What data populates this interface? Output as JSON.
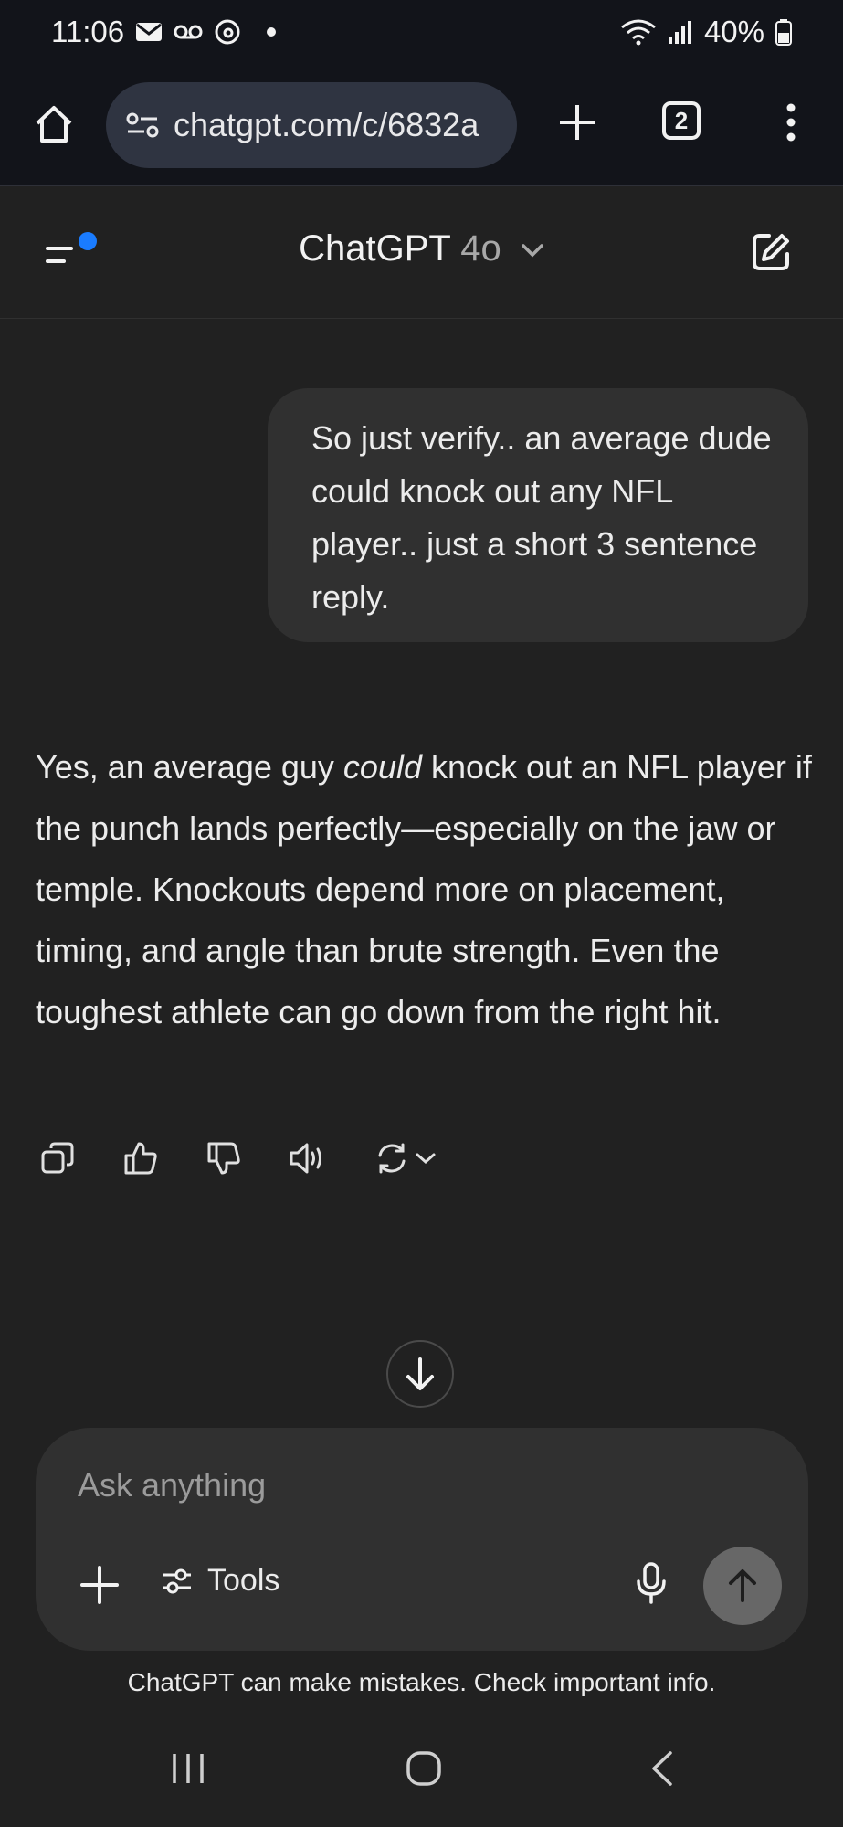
{
  "status_bar": {
    "time": "11:06",
    "battery": "40%",
    "icons": [
      "mail-icon",
      "voicemail-icon",
      "threads-icon",
      "notification-dot",
      "wifi-icon",
      "signal-icon",
      "battery-icon"
    ]
  },
  "browser": {
    "url": "chatgpt.com/c/6832a",
    "tab_count": "2"
  },
  "header": {
    "model_name": "ChatGPT",
    "model_version": "4o"
  },
  "conversation": {
    "user_message": "So just verify..  an average dude could knock out any NFL player..  just a short 3 sentence reply.",
    "assistant_parts": {
      "p1": "Yes, an average guy ",
      "emph": "could",
      "p2": " knock out an NFL player if the punch lands perfectly—especially on the jaw or temple. Knockouts depend more on placement, timing, and angle than brute strength. Even the toughest athlete can go down from the right hit."
    }
  },
  "composer": {
    "placeholder": "Ask anything",
    "tools_label": "Tools"
  },
  "disclaimer": "ChatGPT can make mistakes. Check important info.",
  "colors": {
    "background": "#212121",
    "bubble": "#303030",
    "accent_dot": "#1a7cff",
    "browser_bar": "#12141a"
  }
}
